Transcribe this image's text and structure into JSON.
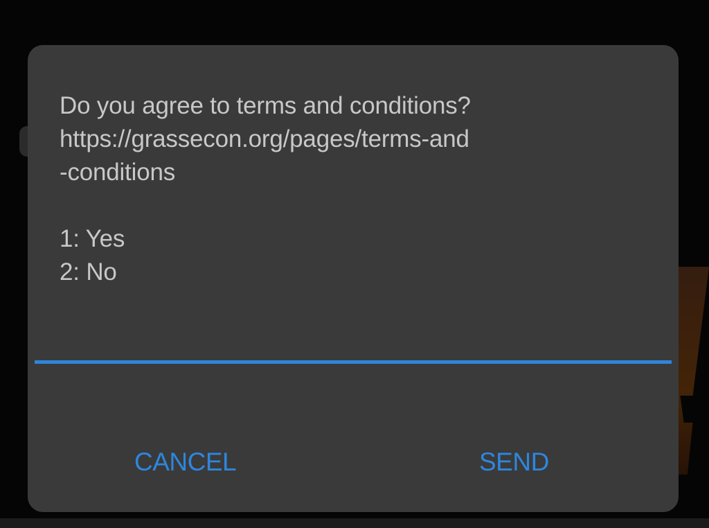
{
  "dialog": {
    "message_lines": [
      "Do you agree to terms and conditions?",
      "https://grassecon.org/pages/terms-and",
      "-conditions"
    ],
    "options": [
      "1: Yes",
      "2: No"
    ],
    "input": {
      "value": "",
      "placeholder": ""
    },
    "cancel_label": "CANCEL",
    "send_label": "SEND"
  },
  "colors": {
    "dialog_background": "#3a3a3a",
    "accent": "#2e86de",
    "text": "#c8c8c8",
    "backdrop": "#050505"
  }
}
